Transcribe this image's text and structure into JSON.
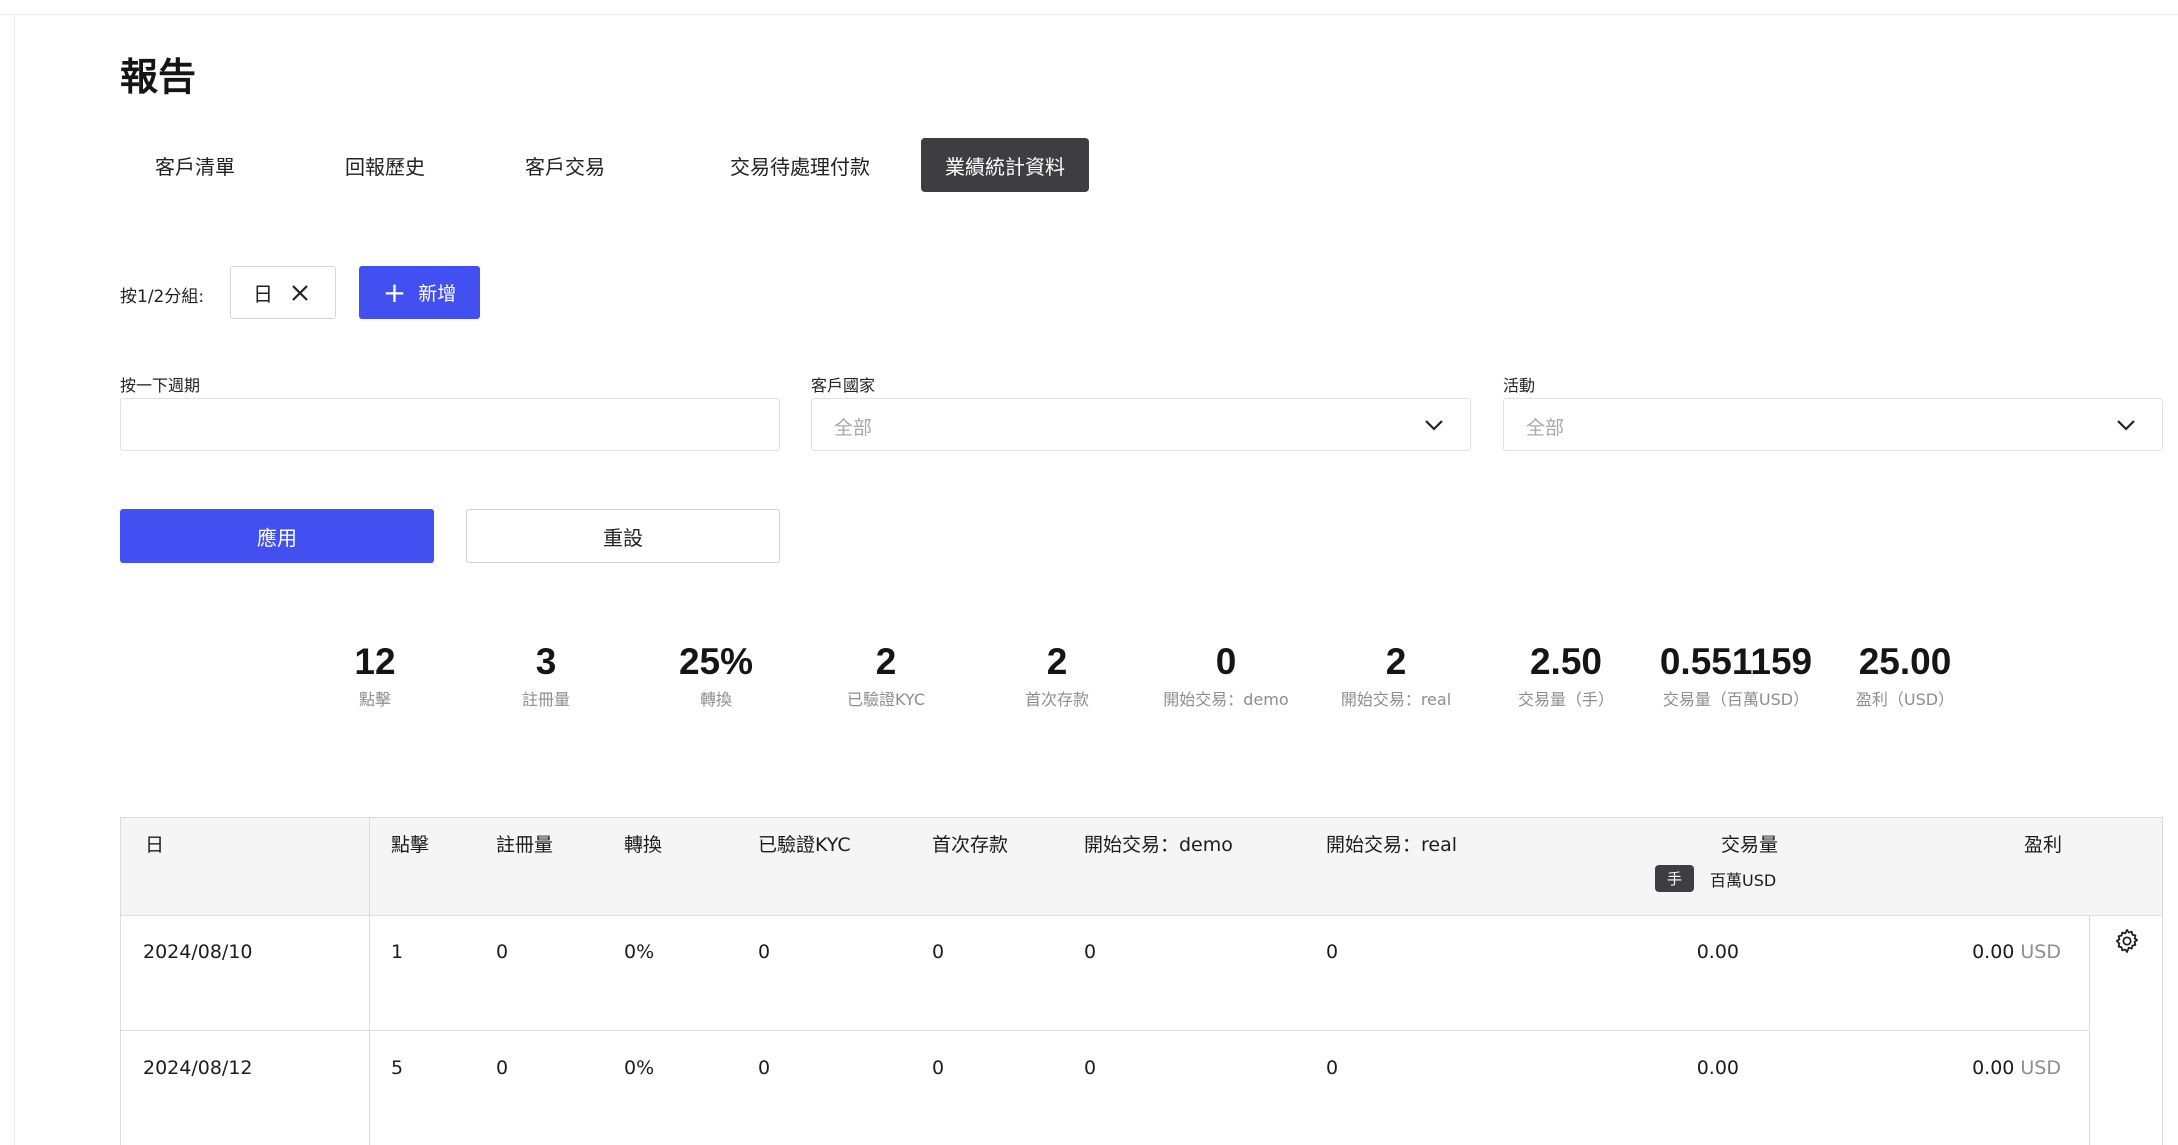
{
  "page": {
    "title": "報告"
  },
  "tabs": [
    {
      "label": "客戶清單",
      "active": false
    },
    {
      "label": "回報歷史",
      "active": false
    },
    {
      "label": "客戶交易",
      "active": false
    },
    {
      "label": "交易待處理付款",
      "active": false
    },
    {
      "label": "業績統計資料",
      "active": true
    }
  ],
  "grouping": {
    "label": "按1/2分組:",
    "chips": [
      {
        "label": "日",
        "icon": "close-icon"
      }
    ],
    "add_label": "新增",
    "add_icon": "plus-icon"
  },
  "filters": {
    "period": {
      "label": "按一下週期",
      "value": ""
    },
    "country": {
      "label": "客戶國家",
      "value": "全部",
      "icon": "chevron-down-icon"
    },
    "campaign": {
      "label": "活動",
      "value": "全部",
      "icon": "chevron-down-icon"
    }
  },
  "actions": {
    "apply": "應用",
    "reset": "重設"
  },
  "summary": [
    {
      "value": "12",
      "label": "點擊"
    },
    {
      "value": "3",
      "label": "註冊量"
    },
    {
      "value": "25%",
      "label": "轉換"
    },
    {
      "value": "2",
      "label": "已驗證KYC"
    },
    {
      "value": "2",
      "label": "首次存款"
    },
    {
      "value": "0",
      "label": "開始交易：demo"
    },
    {
      "value": "2",
      "label": "開始交易：real"
    },
    {
      "value": "2.50",
      "label": "交易量（手）"
    },
    {
      "value": "0.551159",
      "label": "交易量（百萬USD）"
    },
    {
      "value": "25.00",
      "label": "盈利（USD）"
    }
  ],
  "table": {
    "headers": [
      "日",
      "點擊",
      "註冊量",
      "轉換",
      "已驗證KYC",
      "首次存款",
      "開始交易：demo",
      "開始交易：real",
      "交易量",
      "盈利"
    ],
    "volume_units": {
      "active": "手",
      "alt": "百萬USD"
    },
    "rows": [
      {
        "date": "2024/08/10",
        "clicks": "1",
        "registrations": "0",
        "conversion": "0%",
        "kyc": "0",
        "ftd": "0",
        "demo": "0",
        "real": "0",
        "volume": "0.00",
        "profit": "0.00",
        "currency": "USD"
      },
      {
        "date": "2024/08/12",
        "clicks": "5",
        "registrations": "0",
        "conversion": "0%",
        "kyc": "0",
        "ftd": "0",
        "demo": "0",
        "real": "0",
        "volume": "0.00",
        "profit": "0.00",
        "currency": "USD"
      }
    ],
    "settings_icon": "gear-icon"
  },
  "colors": {
    "primary": "#4250f2",
    "active_tab": "#3d3d42",
    "muted_text": "#8e8e8e",
    "border": "#dcdcdc"
  }
}
